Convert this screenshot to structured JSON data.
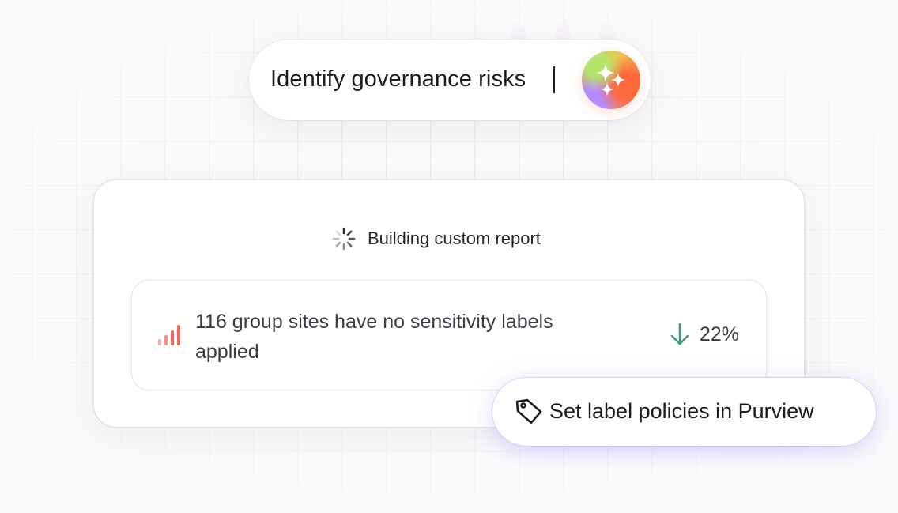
{
  "prompt": {
    "text": "Identify governance risks",
    "ai_icon": "sparkles-icon"
  },
  "report": {
    "status_text": "Building custom report",
    "status_icon": "loading-spinner-icon",
    "insight": {
      "icon": "signal-bars-icon",
      "text": "116 group sites have no sensitivity labels applied",
      "delta_icon": "arrow-down-icon",
      "delta_value": "22%"
    }
  },
  "action": {
    "icon": "tag-icon",
    "label": "Set label policies in Purview"
  },
  "colors": {
    "accent_glow": "#9682ff",
    "bars_red": "#f2685e",
    "delta_green": "#3f9a7e",
    "text_dark": "#1d1b22"
  }
}
